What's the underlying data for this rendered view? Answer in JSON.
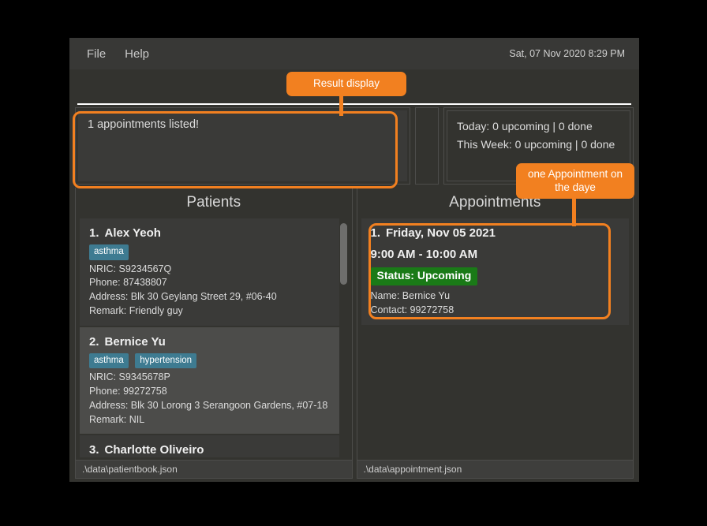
{
  "window": {
    "menu": [
      {
        "label": "File"
      },
      {
        "label": "Help"
      }
    ],
    "clock": "Sat, 07 Nov 2020 8:29 PM"
  },
  "command": {
    "value": "",
    "placeholder": ""
  },
  "result_display": {
    "text": "1 appointments listed!"
  },
  "stats": {
    "today": "Today: 0 upcoming | 0 done",
    "this_week": "This Week: 0 upcoming | 0 done"
  },
  "patients": {
    "title": "Patients",
    "items": [
      {
        "index": "1.",
        "name": "Alex Yeoh",
        "tags": [
          "asthma"
        ],
        "nric": "NRIC: S9234567Q",
        "phone": "Phone: 87438807",
        "address": "Address: Blk 30 Geylang Street 29, #06-40",
        "remark": "Remark: Friendly guy"
      },
      {
        "index": "2.",
        "name": "Bernice Yu",
        "tags": [
          "asthma",
          "hypertension"
        ],
        "nric": "NRIC: S9345678P",
        "phone": "Phone: 99272758",
        "address": "Address: Blk 30 Lorong 3 Serangoon Gardens, #07-18",
        "remark": "Remark: NIL"
      },
      {
        "index": "3.",
        "name": "Charlotte Oliveiro"
      }
    ]
  },
  "appointments": {
    "title": "Appointments",
    "items": [
      {
        "index": "1.",
        "date": "Friday, Nov 05 2021",
        "time": "9:00 AM - 10:00 AM",
        "status": "Status: Upcoming",
        "name": "Name: Bernice Yu",
        "contact": "Contact: 99272758"
      }
    ]
  },
  "status_bar": {
    "patients_path": ".\\data\\patientbook.json",
    "appointments_path": ".\\data\\appointment.json"
  },
  "annotations": {
    "result_display_label": "Result display",
    "appointment_day_label": "one Appointment on the daye"
  },
  "colors": {
    "accent": "#f28020",
    "tag": "#3e7b91",
    "status_upcoming": "#1a7a17",
    "window_bg": "#33332f"
  }
}
